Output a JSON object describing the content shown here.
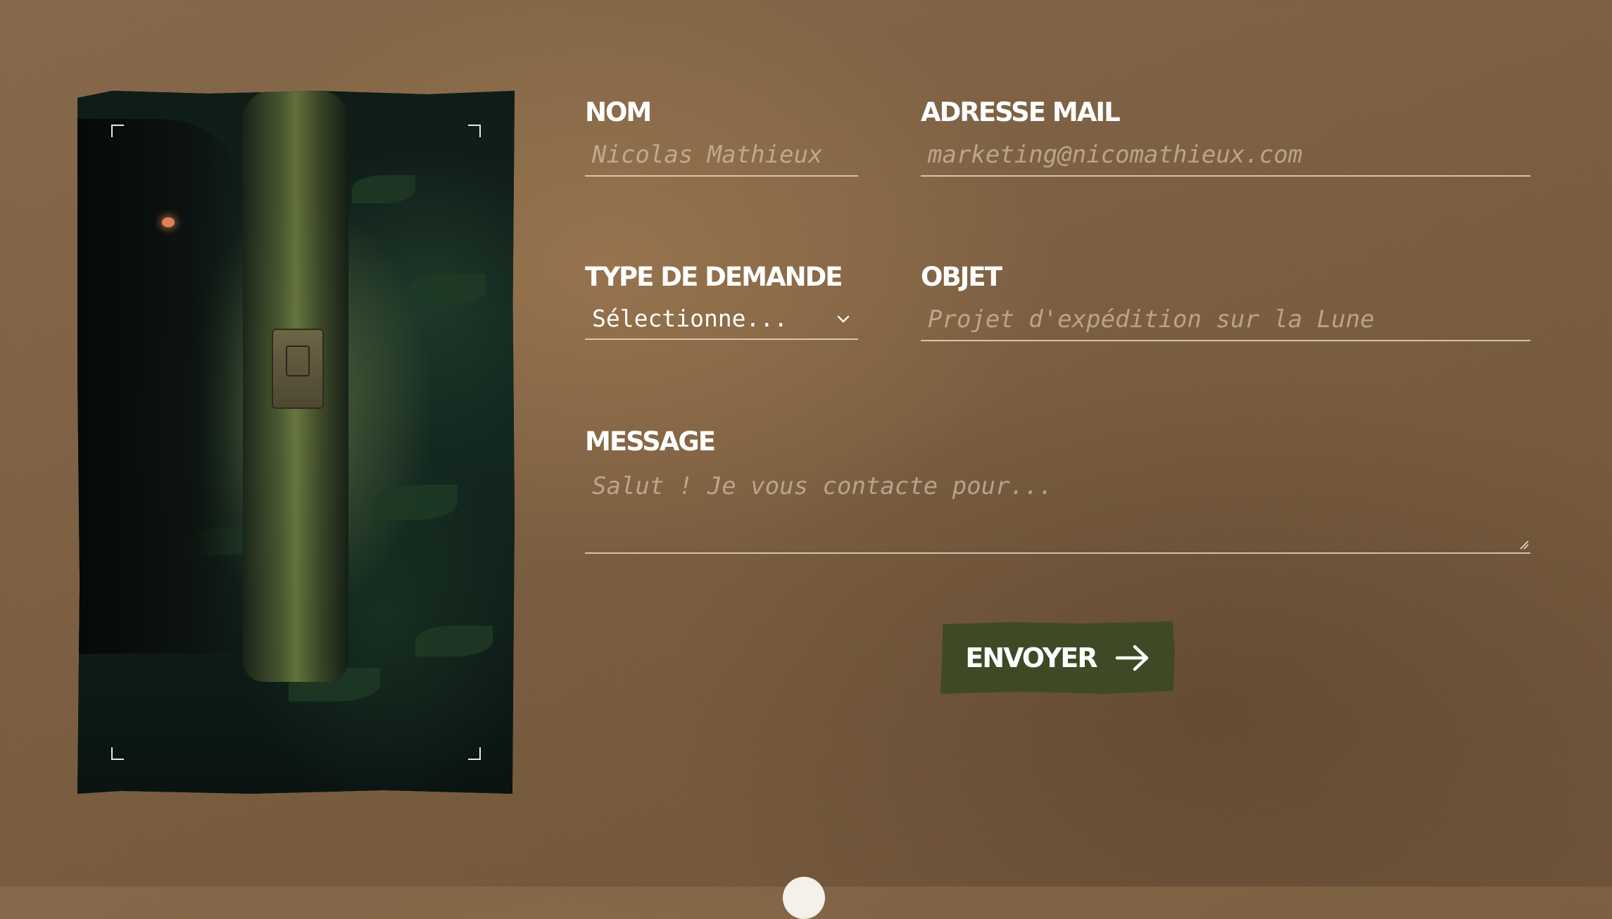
{
  "form": {
    "name": {
      "label": "NOM",
      "placeholder": "Nicolas Mathieux"
    },
    "email": {
      "label": "ADRESSE MAIL",
      "placeholder": "marketing@nicomathieux.com"
    },
    "request_type": {
      "label": "TYPE DE DEMANDE",
      "selected": "Sélectionne..."
    },
    "subject": {
      "label": "OBJET",
      "placeholder": "Projet d'expédition sur la Lune"
    },
    "message": {
      "label": "MESSAGE",
      "placeholder": "Salut ! Je vous contacte pour..."
    },
    "submit_label": "ENVOYER"
  },
  "icons": {
    "submit": "arrow-right-icon",
    "select": "chevron-down-icon"
  },
  "colors": {
    "background": "#7c5f42",
    "button": "#3e4a26",
    "text": "#ffffff"
  }
}
